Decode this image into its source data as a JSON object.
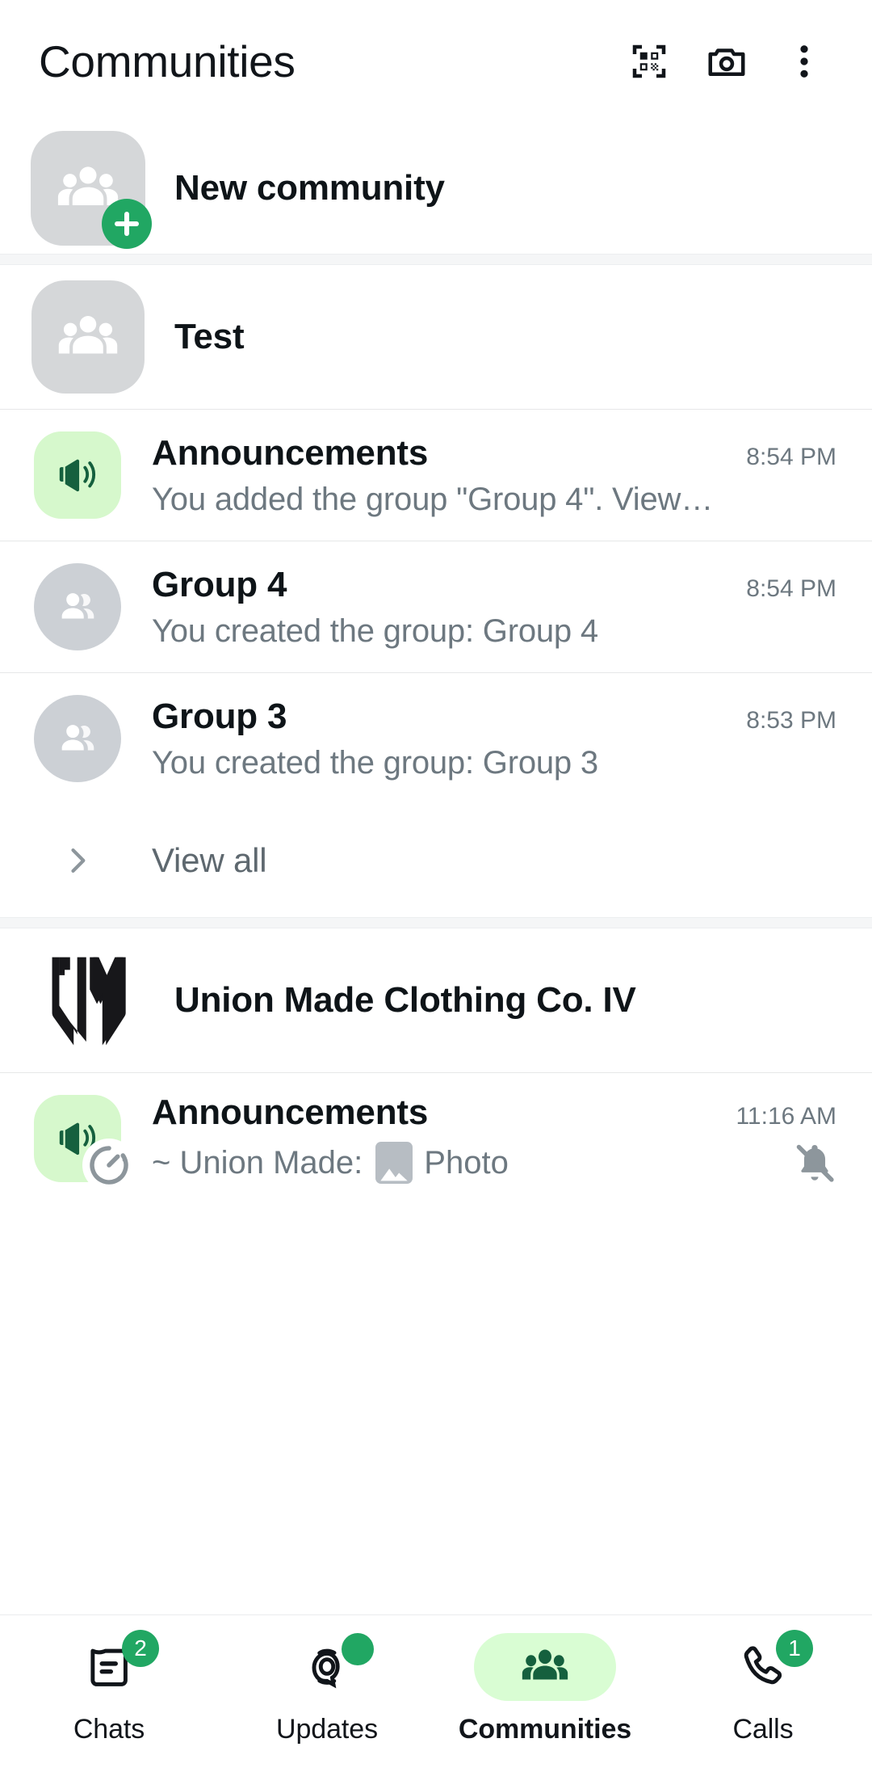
{
  "header": {
    "title": "Communities",
    "actions": [
      {
        "name": "qr-scan-icon",
        "label": "Scan QR code"
      },
      {
        "name": "camera-icon",
        "label": "Camera"
      },
      {
        "name": "overflow-menu-icon",
        "label": "More options"
      }
    ]
  },
  "new_community": {
    "label": "New community",
    "avatar_icon": "group-icon",
    "badge_icon": "plus-icon",
    "avatar_bg": "#d5d7d9",
    "badge_bg": "#21a763"
  },
  "communities": [
    {
      "name": "Test",
      "avatar_icon": "group-icon",
      "avatar_bg": "#d5d7d9",
      "logo_type": "group-glyph",
      "chats": [
        {
          "name": "Announcements",
          "subtitle": "You added the group \"Group 4\". View…",
          "time": "8:54 PM",
          "icon": "megaphone-icon",
          "icon_bg": "#d6f8cc",
          "icon_color": "#15603e",
          "avatar_shape": "square",
          "muted": false,
          "timer": false
        },
        {
          "name": "Group 4",
          "subtitle": "You created the group: Group 4",
          "time": "8:54 PM",
          "icon": "group-icon",
          "icon_bg": "#ccd0d5",
          "icon_color": "#ffffff",
          "avatar_shape": "circle",
          "muted": false,
          "timer": false
        },
        {
          "name": "Group 3",
          "subtitle": "You created the group: Group 3",
          "time": "8:53 PM",
          "icon": "group-icon",
          "icon_bg": "#ccd0d5",
          "icon_color": "#ffffff",
          "avatar_shape": "circle",
          "muted": false,
          "timer": false
        }
      ],
      "view_all": {
        "label": "View all",
        "icon": "chevron-right-icon"
      }
    },
    {
      "name": "Union Made Clothing Co. IV",
      "avatar_icon": "um-monogram-logo",
      "logo_type": "um-monogram",
      "chats": [
        {
          "name": "Announcements",
          "subtitle_prefix": "~ Union Made:",
          "subtitle_attachment": "Photo",
          "attachment_icon": "photo-icon",
          "time": "11:16 AM",
          "icon": "megaphone-icon",
          "icon_bg": "#d6f8cc",
          "icon_color": "#15603e",
          "avatar_shape": "square",
          "muted": true,
          "mute_icon": "bell-muted-icon",
          "timer": true,
          "timer_icon": "disappearing-timer-icon"
        }
      ]
    }
  ],
  "bottom_nav": {
    "active": "Communities",
    "items": [
      {
        "label": "Chats",
        "icon": "chats-icon",
        "badge": "2",
        "badge_type": "count",
        "active": false
      },
      {
        "label": "Updates",
        "icon": "updates-icon",
        "badge": "",
        "badge_type": "dot",
        "active": false
      },
      {
        "label": "Communities",
        "icon": "communities-icon",
        "badge": "",
        "badge_type": "none",
        "active": true
      },
      {
        "label": "Calls",
        "icon": "calls-icon",
        "badge": "1",
        "badge_type": "count",
        "active": false
      }
    ]
  },
  "colors": {
    "accent_green": "#21a763",
    "pill_green": "#d9fdd3",
    "icon_dark_green": "#15603e",
    "text_primary": "#0e1418",
    "text_secondary": "#6d7880",
    "divider": "#e6e7e8",
    "band": "#f5f6f7"
  }
}
